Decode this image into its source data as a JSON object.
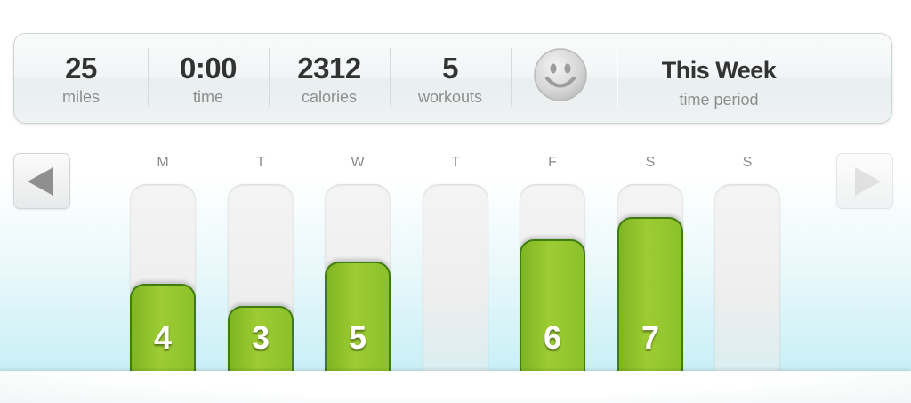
{
  "stats": {
    "miles": {
      "value": "25",
      "label": "miles"
    },
    "time": {
      "value": "0:00",
      "label": "time"
    },
    "calories": {
      "value": "2312",
      "label": "calories"
    },
    "workouts": {
      "value": "5",
      "label": "workouts"
    },
    "period": {
      "value": "This Week",
      "label": "time period"
    }
  },
  "mood_icon": "smiley-face-icon",
  "navigation": {
    "prev_icon": "left-arrow-icon",
    "next_icon": "right-arrow-icon"
  },
  "colors": {
    "bar_fill": "#8cc12b",
    "bar_border": "#3f7d10"
  },
  "chart_data": {
    "type": "bar",
    "categories": [
      "M",
      "T",
      "W",
      "T",
      "F",
      "S",
      "S"
    ],
    "values": [
      4,
      3,
      5,
      null,
      6,
      7,
      null
    ],
    "ylim": [
      0,
      8.5
    ]
  }
}
